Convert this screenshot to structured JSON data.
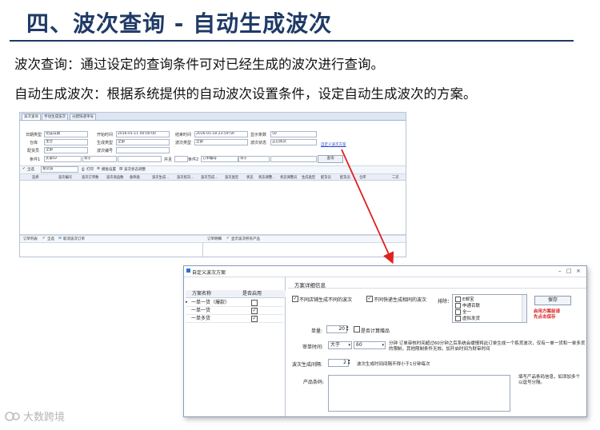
{
  "slide": {
    "title": "四、波次查询 - 自动生成波次",
    "desc1": "波次查询：通过设定的查询条件可对已经生成的波次进行查询。",
    "desc2": "自动生成波次：根据系统提供的自动波次设置条件，设定自动生成波次的方案。"
  },
  "app": {
    "tabs": [
      "波次查询",
      "手动生成波次",
      "分配快递单号"
    ],
    "filters": {
      "date_type_label": "日期类型",
      "date_type_value": "完成日期",
      "start_label": "开始时间",
      "start_value": "2016-01-11 00:00:00",
      "end_label": "结束时间",
      "end_value": "2016-01-18 23:59:59",
      "show_count_label": "显示条数",
      "show_count_value": "50",
      "warehouse_label": "仓库",
      "warehouse_value": "主仓",
      "gen_type_label": "生成类型",
      "gen_type_value": "全部",
      "wave_type_label": "波次类型",
      "wave_type_value": "全部",
      "wave_status_label": "波次状态",
      "wave_status_value": "正在拣货",
      "picker_label": "配货员",
      "picker_value": "全部",
      "wave_no_label": "波次编号",
      "cond1_label": "条件1",
      "cond1_field": "买家ID",
      "cond1_op": "等于",
      "and_label": "并且",
      "cond2_label": "条件2",
      "cond2_field": "订单编号",
      "cond2_op": "等于",
      "query_button": "查询",
      "auto_wave_link": "自定义波次方案"
    },
    "toolbar": {
      "select_all": "全选",
      "sent_wave": "发货波",
      "print": "打印",
      "template": "模板设置",
      "wave_status_adjust": "波次状态调整"
    },
    "grid_columns": [
      "选择",
      "波次编号",
      "波次订单数",
      "波次商品数",
      "备称类",
      "波次生成...",
      "波次拣货...",
      "波次完成...",
      "波次类型",
      "状态",
      "状态调整...",
      "状态调整员",
      "生成类型",
      "配货员",
      "配货员",
      "仓库",
      "二次"
    ],
    "bottom_left": {
      "order_list": "订单列表",
      "select_all": "全选",
      "cancel_wave_order": "取消波次订单"
    },
    "bottom_right": {
      "order_detail": "订单明细",
      "show_all_products": "显示波次所有产品"
    }
  },
  "dialog": {
    "title": "自定义波次方案",
    "scheme_name_header": "方案名称",
    "enabled_header": "是否启用",
    "schemes": [
      {
        "name": "一单一货（爆款）",
        "enabled": false
      },
      {
        "name": "一单一货",
        "enabled": true
      },
      {
        "name": "一单多货",
        "enabled": true
      }
    ],
    "detail_header": "方案详细信息",
    "opt_diff_shop": "不同店铺生成不同的波次",
    "opt_diff_shop_checked": true,
    "opt_diff_express": "不同快递生成相同的波次",
    "opt_diff_express_checked": true,
    "exclude_label": "排除：",
    "exclude_items": [
      "E邮宝",
      "申通百联",
      "全一",
      "虚拟发货"
    ],
    "save_button": "保存",
    "red_note": "启用方案前请\n先点击保存",
    "quantity_label": "单量:",
    "quantity_value": "20",
    "count_gift_label": "是否计算赠品",
    "count_gift_checked": false,
    "audit_time_label": "审单时间:",
    "audit_op": "大于",
    "audit_value": "60",
    "audit_note": "分钟 订单审核时间超过60分钟之后系统会缓慢将此订单生成一个拣货波次，仅有一单一货和一单多货的限制，其他限制条件无效。加开启时间为财审时间",
    "interval_label": "波次生成间隔:",
    "interval_value": "2",
    "interval_note": "波次生成时间间隔不得小于1分钟每次",
    "barcode_label": "产品条码:",
    "barcode_note": "填写产品条码信息，如添加多个以逗号分隔。"
  },
  "watermark": "大数跨境",
  "colors": {
    "title": "#1f3a66",
    "arrow": "#e02020",
    "note_red": "#d81f1f"
  }
}
